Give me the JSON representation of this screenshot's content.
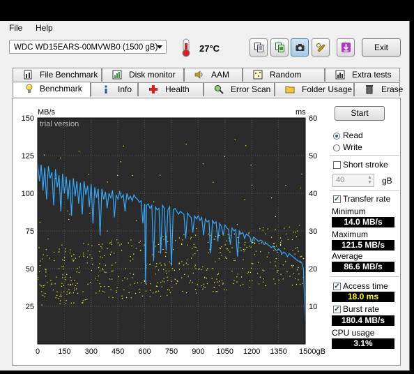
{
  "menu": {
    "file": "File",
    "help": "Help"
  },
  "toolbar": {
    "drive": "WDC WD15EARS-00MVWB0 (1500 gB)",
    "temperature": "27°C",
    "exit_label": "Exit",
    "icons": [
      "copy-icon",
      "copy-text-icon",
      "screenshot-camera-icon",
      "wrench-options-icon",
      "save-download-icon"
    ]
  },
  "tabs_top": [
    {
      "label": "File Benchmark",
      "icon": "file-benchmark-icon"
    },
    {
      "label": "Disk monitor",
      "icon": "disk-monitor-icon"
    },
    {
      "label": "AAM",
      "icon": "speaker-icon"
    },
    {
      "label": "Random Access",
      "icon": "random-access-icon"
    },
    {
      "label": "Extra tests",
      "icon": "extra-tests-icon"
    }
  ],
  "tabs_bottom": [
    {
      "label": "Benchmark",
      "icon": "benchmark-bulb-icon",
      "active": true
    },
    {
      "label": "Info",
      "icon": "info-icon"
    },
    {
      "label": "Health",
      "icon": "health-cross-icon"
    },
    {
      "label": "Error Scan",
      "icon": "magnifier-icon"
    },
    {
      "label": "Folder Usage",
      "icon": "folder-icon"
    },
    {
      "label": "Erase",
      "icon": "trash-icon"
    }
  ],
  "benchmark": {
    "start_label": "Start",
    "read_label": "Read",
    "write_label": "Write",
    "short_stroke_label": "Short stroke",
    "short_stroke_value": "40",
    "short_stroke_unit": "gB",
    "transfer_rate_label": "Transfer rate",
    "minimum_label": "Minimum",
    "minimum_value": "14.0 MB/s",
    "maximum_label": "Maximum",
    "maximum_value": "121.5 MB/s",
    "average_label": "Average",
    "average_value": "86.6 MB/s",
    "access_time_label": "Access time",
    "access_time_value": "18.0 ms",
    "burst_rate_label": "Burst rate",
    "burst_rate_value": "180.4 MB/s",
    "cpu_usage_label": "CPU usage",
    "cpu_usage_value": "3.1%"
  },
  "chart_data": {
    "type": "line",
    "watermark": "trial version",
    "left_unit": "MB/s",
    "right_unit": "ms",
    "y_left_ticks": [
      "150",
      "125",
      "100",
      "75",
      "50",
      "25"
    ],
    "y_right_ticks": [
      "60",
      "50",
      "40",
      "30",
      "20",
      "10"
    ],
    "x_ticks": [
      "0",
      "150",
      "300",
      "450",
      "600",
      "750",
      "900",
      "1050",
      "1200",
      "1350",
      "1500gB"
    ],
    "xlim": [
      0,
      1500
    ],
    "ylim_left": [
      0,
      150
    ],
    "ylim_right": [
      0,
      60
    ],
    "transfer_series": {
      "name": "Transfer rate",
      "color": "#33aaff",
      "x": [
        0,
        10,
        20,
        30,
        40,
        50,
        60,
        70,
        80,
        90,
        100,
        110,
        120,
        130,
        140,
        150,
        160,
        170,
        180,
        190,
        200,
        210,
        220,
        230,
        240,
        250,
        260,
        270,
        280,
        290,
        300,
        310,
        320,
        330,
        340,
        350,
        360,
        370,
        380,
        390,
        400,
        410,
        420,
        430,
        440,
        450,
        460,
        470,
        480,
        490,
        500,
        510,
        520,
        530,
        540,
        550,
        560,
        570,
        580,
        590,
        600,
        605,
        610,
        620,
        630,
        640,
        650,
        660,
        670,
        680,
        690,
        700,
        710,
        720,
        730,
        740,
        750,
        760,
        770,
        780,
        790,
        800,
        810,
        820,
        830,
        840,
        850,
        860,
        870,
        880,
        890,
        900,
        910,
        920,
        930,
        940,
        950,
        960,
        970,
        980,
        990,
        1000,
        1010,
        1020,
        1030,
        1040,
        1050,
        1060,
        1070,
        1080,
        1090,
        1100,
        1110,
        1120,
        1130,
        1140,
        1150,
        1160,
        1170,
        1180,
        1190,
        1200,
        1210,
        1220,
        1230,
        1240,
        1250,
        1260,
        1270,
        1280,
        1290,
        1300,
        1310,
        1320,
        1330,
        1340,
        1350,
        1360,
        1370,
        1380,
        1390,
        1400,
        1410,
        1420,
        1430,
        1440,
        1450,
        1460,
        1470,
        1480,
        1490,
        1500
      ],
      "y": [
        120,
        108,
        119,
        102,
        117,
        96,
        118,
        110,
        114,
        92,
        116,
        104,
        112,
        88,
        113,
        100,
        111,
        96,
        109,
        85,
        110,
        98,
        108,
        93,
        107,
        86,
        108,
        99,
        105,
        91,
        106,
        80,
        104,
        97,
        103,
        72,
        103,
        96,
        101,
        90,
        100,
        97,
        102,
        84,
        99,
        96,
        101,
        97,
        99,
        88,
        100,
        96,
        98,
        95,
        99,
        97,
        96,
        94,
        95,
        80,
        93,
        40,
        92,
        93,
        90,
        92,
        55,
        91,
        89,
        90,
        60,
        92,
        90,
        62,
        89,
        91,
        52,
        89,
        90,
        88,
        86,
        88,
        87,
        86,
        70,
        87,
        85,
        84,
        74,
        85,
        83,
        85,
        82,
        84,
        72,
        83,
        81,
        82,
        60,
        82,
        80,
        81,
        68,
        80,
        78,
        72,
        79,
        77,
        76,
        66,
        77,
        75,
        76,
        58,
        75,
        73,
        74,
        70,
        73,
        72,
        71,
        67,
        71,
        70,
        69,
        68,
        69,
        68,
        66,
        67,
        66,
        65,
        64,
        65,
        63,
        62,
        63,
        62,
        60,
        61,
        60,
        58,
        60,
        59,
        58,
        57,
        56,
        55,
        55,
        54,
        50,
        15
      ]
    },
    "access_series": {
      "name": "Access time",
      "color": "#ffff33",
      "range_ms": [
        10,
        26
      ]
    }
  }
}
